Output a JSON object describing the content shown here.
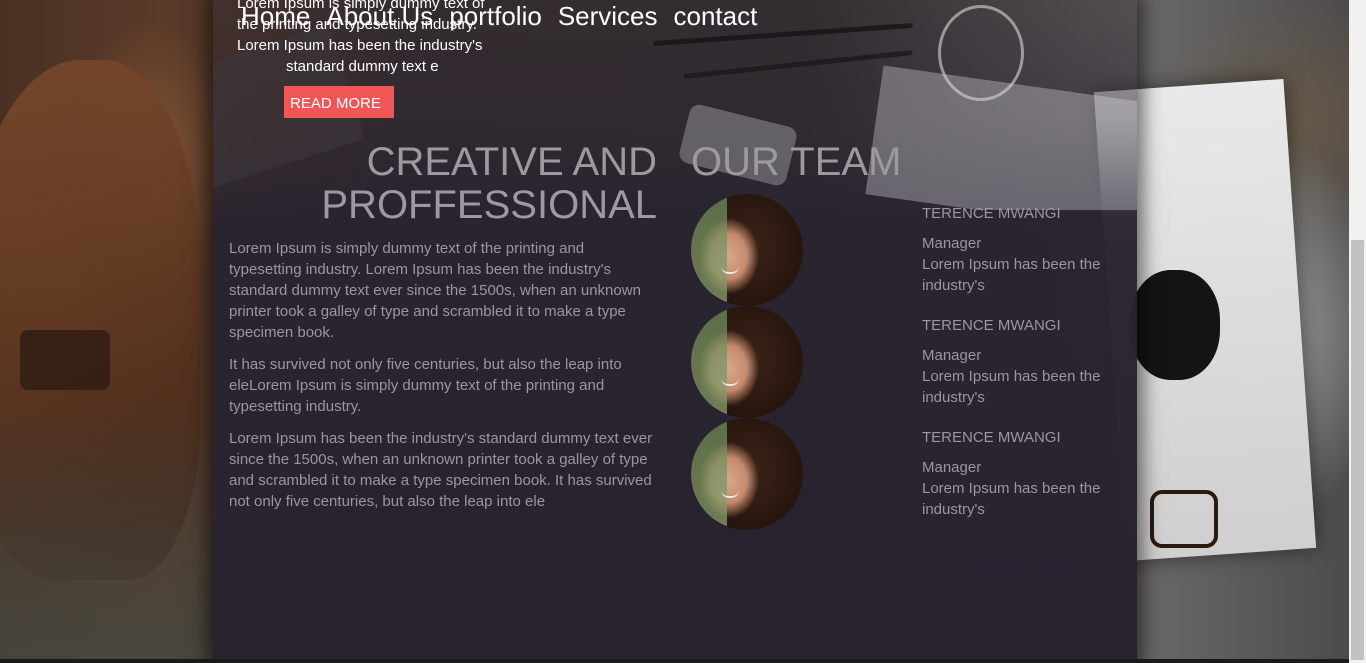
{
  "nav": {
    "items": [
      "Home",
      "About Us",
      "portfolio",
      "Services",
      "contact"
    ]
  },
  "hero": {
    "line1": "Lorem Ipsum is simply dummy text of",
    "line2": "the printing and typesetting industry.",
    "line3": "Lorem Ipsum has been the industry's",
    "line4": "standard dummy text e",
    "button_label": "READ MORE"
  },
  "creative": {
    "title_line1": "CREATIVE AND",
    "title_line2": "PROFFESSIONAL",
    "paragraphs": [
      "Lorem Ipsum is simply dummy text of the printing and typesetting industry. Lorem Ipsum has been the industry's standard dummy text ever since the 1500s, when an unknown printer took a galley of type and scrambled it to make a type specimen book.",
      "It has survived not only five centuries, but also the leap into eleLorem Ipsum is simply dummy text of the printing and typesetting industry.",
      "Lorem Ipsum has been the industry's standard dummy text ever since the 1500s, when an unknown printer took a galley of type and scrambled it to make a type specimen book. It has survived not only five centuries, but also the leap into ele"
    ]
  },
  "team": {
    "title": "OUR TEAM",
    "members": [
      {
        "name": "TERENCE MWANGI",
        "role": "Manager",
        "desc": "Lorem Ipsum has been the industry's"
      },
      {
        "name": "TERENCE MWANGI",
        "role": "Manager",
        "desc": "Lorem Ipsum has been the industry's"
      },
      {
        "name": "TERENCE MWANGI",
        "role": "Manager",
        "desc": "Lorem Ipsum has been the industry's"
      }
    ]
  },
  "colors": {
    "accent": "#f25556",
    "panel": "#29222f",
    "text_muted": "#9a979e"
  }
}
